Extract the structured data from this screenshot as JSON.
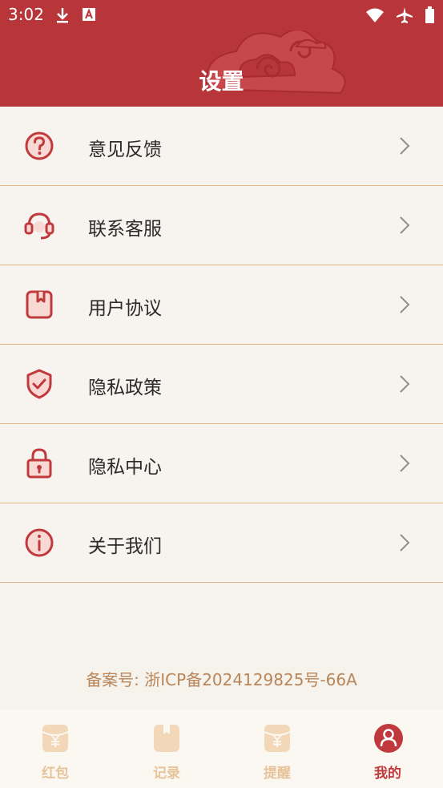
{
  "status_bar": {
    "time": "3:02"
  },
  "header": {
    "title": "设置"
  },
  "settings": {
    "items": [
      {
        "label": "意见反馈",
        "icon": "question-circle-icon"
      },
      {
        "label": "联系客服",
        "icon": "headset-icon"
      },
      {
        "label": "用户协议",
        "icon": "agreement-book-icon"
      },
      {
        "label": "隐私政策",
        "icon": "shield-check-icon"
      },
      {
        "label": "隐私中心",
        "icon": "lock-icon"
      },
      {
        "label": "关于我们",
        "icon": "info-circle-icon"
      }
    ]
  },
  "footer": {
    "icp": "备案号: 浙ICP备2024129825号-66A"
  },
  "tabbar": {
    "tabs": [
      {
        "label": "红包",
        "icon": "red-envelope-icon",
        "active": false
      },
      {
        "label": "记录",
        "icon": "record-book-icon",
        "active": false
      },
      {
        "label": "提醒",
        "icon": "reminder-envelope-icon",
        "active": false
      },
      {
        "label": "我的",
        "icon": "profile-icon",
        "active": true
      }
    ]
  },
  "colors": {
    "brand": "#b8363a",
    "icon": "#c0393d",
    "divider": "#e3b98b",
    "tab_inactive": "#e7c39a",
    "icp_text": "#b8865a"
  }
}
